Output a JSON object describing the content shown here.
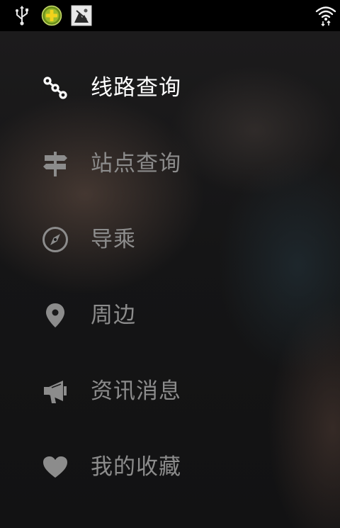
{
  "status_bar": {
    "left_icons": [
      "usb-icon",
      "app-notification-icon",
      "image-notification-icon"
    ],
    "right_icons": [
      "wifi-icon"
    ]
  },
  "menu": {
    "active_index": 0,
    "items": [
      {
        "label": "线路查询",
        "icon": "route-icon"
      },
      {
        "label": "站点查询",
        "icon": "signpost-icon"
      },
      {
        "label": "导乘",
        "icon": "compass-icon"
      },
      {
        "label": "周边",
        "icon": "location-pin-icon"
      },
      {
        "label": "资讯消息",
        "icon": "megaphone-icon"
      },
      {
        "label": "我的收藏",
        "icon": "heart-icon"
      }
    ]
  },
  "colors": {
    "active_text": "#ffffff",
    "inactive_text": "#8c8c8c",
    "status_bar_bg": "#000000"
  }
}
